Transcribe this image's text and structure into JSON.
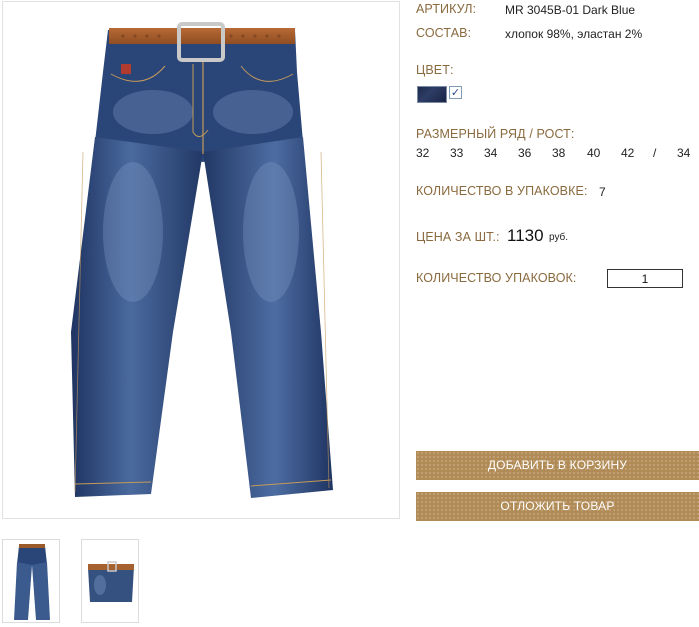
{
  "product": {
    "article_label": "АРТИКУЛ:",
    "article_value": "MR 3045B-01 Dark Blue",
    "composition_label": "СОСТАВ:",
    "composition_value": "хлопок 98%, эластан 2%",
    "color_label": "ЦВЕТ:",
    "color_swatch": {
      "color": "#22304f",
      "selected": true
    },
    "sizes_label": "РАЗМЕРНЫЙ РЯД / РОСТ:",
    "sizes": [
      "32",
      "33",
      "34",
      "36",
      "38",
      "40",
      "42",
      "/",
      "34"
    ],
    "pack_count_label": "КОЛИЧЕСТВО В УПАКОВКЕ:",
    "pack_count_value": "7",
    "price_label": "ЦЕНА ЗА ШТ.:",
    "price_value": "1130",
    "price_unit": "руб.",
    "packs_qty_label": "КОЛИЧЕСТВО УПАКОВОК:",
    "packs_qty_value": "1"
  },
  "actions": {
    "add_to_cart": "ДОБАВИТЬ В КОРЗИНУ",
    "save_item": "ОТЛОЖИТЬ ТОВАР"
  },
  "colors": {
    "label_brown": "#8a6a3e",
    "button_bg": "#b18b55",
    "denim": "#2c426e"
  },
  "images": {
    "main": "jeans-front-with-belt",
    "thumbnails": [
      "jeans-front-thumb",
      "jeans-waist-closeup-thumb"
    ]
  }
}
